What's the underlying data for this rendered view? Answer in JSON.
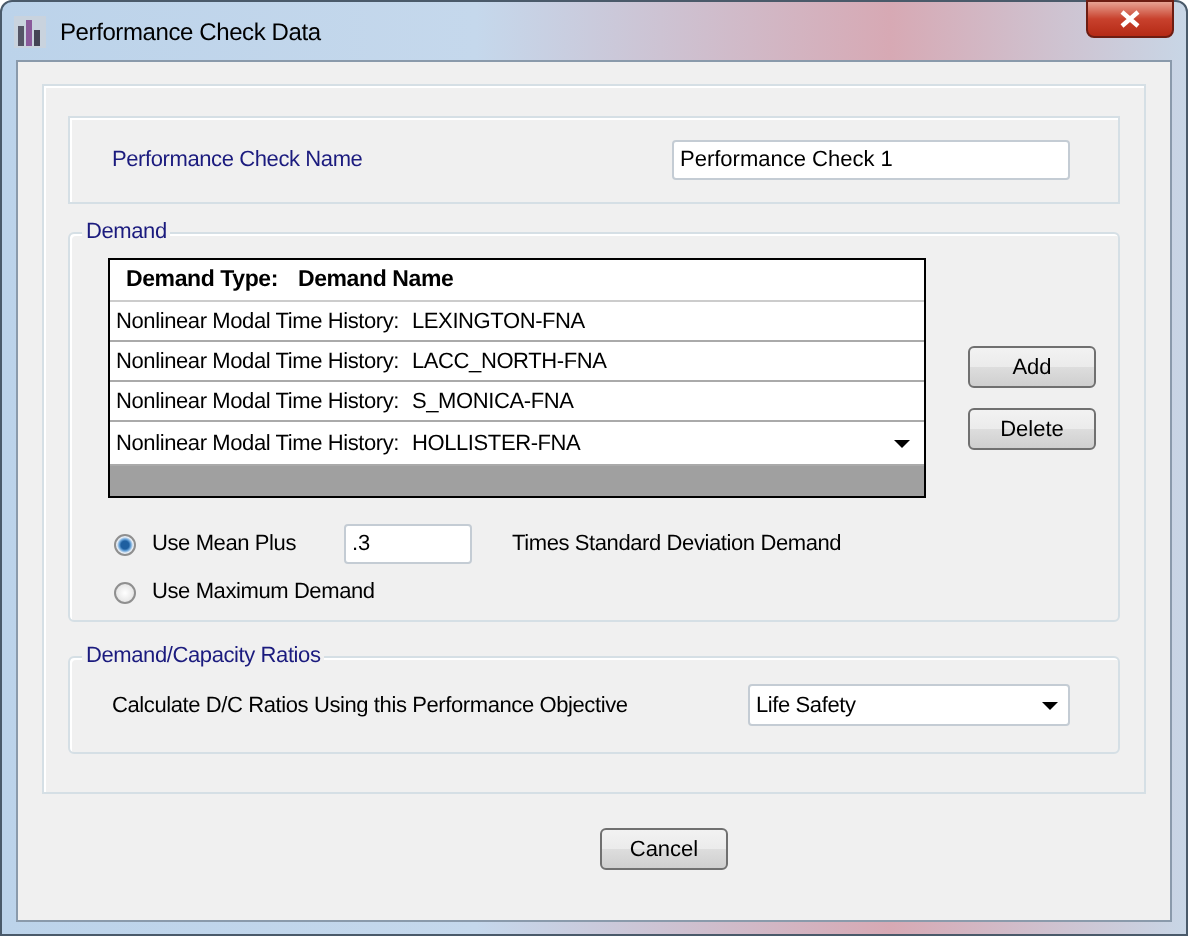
{
  "window": {
    "title": "Performance Check Data"
  },
  "name_section": {
    "label": "Performance Check Name",
    "value": "Performance Check 1"
  },
  "demand": {
    "title": "Demand",
    "table": {
      "columns": [
        "Demand Type:",
        "Demand Name"
      ],
      "rows": [
        {
          "kind": "text",
          "type": "Nonlinear Modal Time History:",
          "name": "LEXINGTON-FNA"
        },
        {
          "kind": "text",
          "type": "Nonlinear Modal Time History:",
          "name": "LACC_NORTH-FNA"
        },
        {
          "kind": "text",
          "type": "Nonlinear Modal Time History:",
          "name": "S_MONICA-FNA"
        },
        {
          "kind": "dropdown",
          "type": "Nonlinear Modal Time History:",
          "name": "HOLLISTER-FNA"
        }
      ]
    },
    "buttons": [
      "Add",
      "Delete"
    ],
    "options": [
      {
        "label": "Use Mean Plus",
        "selected": true,
        "value": ".3",
        "suffix": "Times Standard Deviation Demand"
      },
      {
        "label": "Use Maximum Demand",
        "selected": false
      }
    ]
  },
  "dc_ratios": {
    "title": "Demand/Capacity Ratios",
    "label": "Calculate D/C Ratios Using this Performance Objective",
    "value": "Life Safety"
  },
  "buttons": [
    "Cancel"
  ]
}
